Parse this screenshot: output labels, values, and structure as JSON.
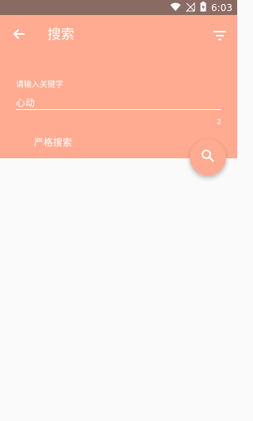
{
  "status_bar": {
    "time": "6:03",
    "icons": [
      "wifi-icon",
      "signal-icon",
      "battery-charging-icon"
    ]
  },
  "appbar": {
    "back_icon": "arrow-back-icon",
    "title": "搜索",
    "filter_icon": "filter-list-icon"
  },
  "search": {
    "label": "请输入关键字",
    "value": "心动",
    "counter": "2",
    "strict_label": "严格搜索"
  },
  "fab": {
    "icon": "search-icon"
  },
  "colors": {
    "status_bar": "#8a6b64",
    "primary": "#ffab91",
    "background": "#fafafa",
    "text_on_primary": "#ffffff"
  }
}
